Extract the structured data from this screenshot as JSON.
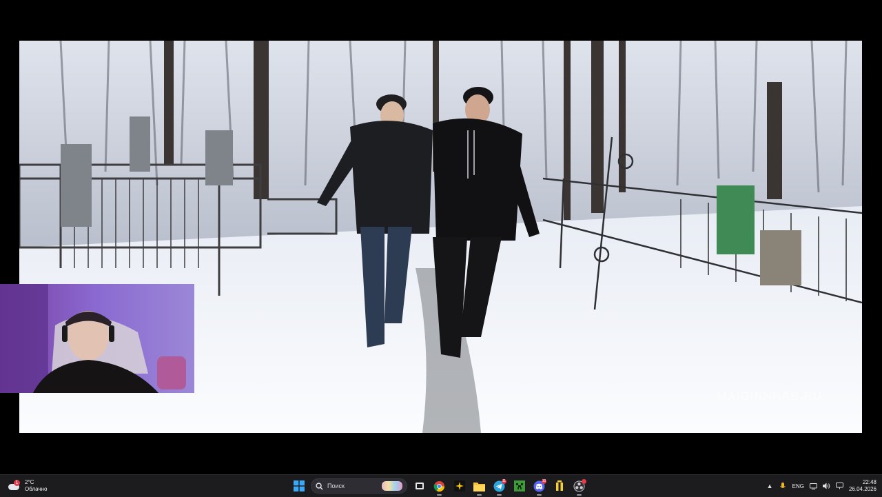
{
  "video": {
    "watermark": "MAIGINNHAB.RU"
  },
  "taskbar": {
    "weather": {
      "temp": "2°C",
      "condition": "Облачно",
      "badge": "1",
      "icon": "cloud-icon"
    },
    "search": {
      "label": "Поиск",
      "icon": "search-icon"
    },
    "apps": [
      {
        "name": "start",
        "icon": "windows-logo-icon"
      },
      {
        "name": "task-view",
        "icon": "task-view-icon"
      },
      {
        "name": "chrome",
        "icon": "chrome-icon"
      },
      {
        "name": "photo-app",
        "icon": "sparkle-icon"
      },
      {
        "name": "file-explorer",
        "icon": "folder-icon"
      },
      {
        "name": "telegram",
        "icon": "telegram-icon",
        "badge": "11"
      },
      {
        "name": "minecraft",
        "icon": "minecraft-icon"
      },
      {
        "name": "discord",
        "icon": "discord-icon",
        "badge": "10"
      },
      {
        "name": "stats-app",
        "icon": "bars-icon"
      },
      {
        "name": "obs",
        "icon": "obs-icon"
      }
    ],
    "tray": {
      "language": "ENG",
      "time": "22:48",
      "date": "26.04.2026"
    }
  }
}
